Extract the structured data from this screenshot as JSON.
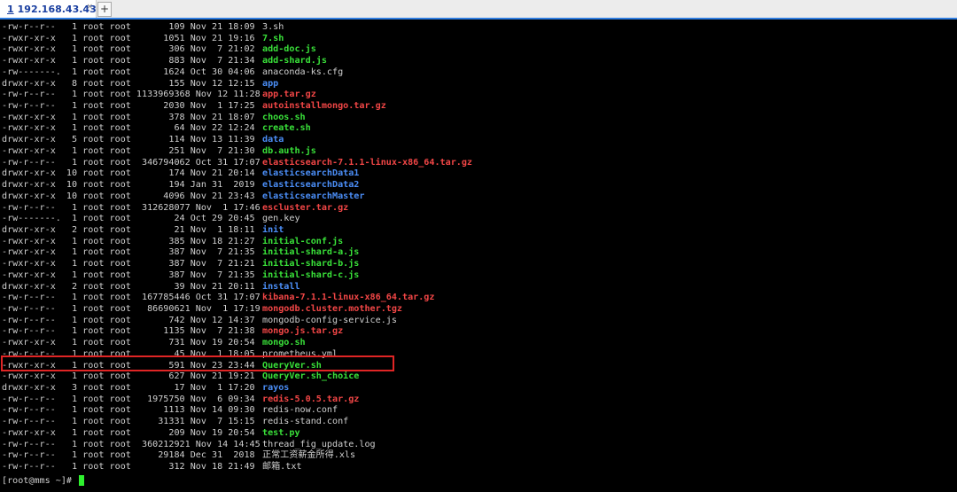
{
  "tab": {
    "number": "1",
    "host": "192.168.43.43",
    "close_glyph": "×",
    "add_glyph": "+"
  },
  "colors": {
    "green": "#39e039",
    "red": "#f24646",
    "blue": "#4b8ef7",
    "white": "#cfcfcf",
    "highlight": "#e02525"
  },
  "listing": [
    {
      "meta": "-rw-r--r--   1 root root       109 Nov 21 18:09",
      "name": "3.sh",
      "color": "white"
    },
    {
      "meta": "-rwxr-xr-x   1 root root      1051 Nov 21 19:16",
      "name": "7.sh",
      "color": "green"
    },
    {
      "meta": "-rwxr-xr-x   1 root root       306 Nov  7 21:02",
      "name": "add-doc.js",
      "color": "green"
    },
    {
      "meta": "-rwxr-xr-x   1 root root       883 Nov  7 21:34",
      "name": "add-shard.js",
      "color": "green"
    },
    {
      "meta": "-rw-------.  1 root root      1624 Oct 30 04:06",
      "name": "anaconda-ks.cfg",
      "color": "white"
    },
    {
      "meta": "drwxr-xr-x   8 root root       155 Nov 12 12:15",
      "name": "app",
      "color": "blue"
    },
    {
      "meta": "-rw-r--r--   1 root root 1133969368 Nov 12 11:28",
      "name": "app.tar.gz",
      "color": "red"
    },
    {
      "meta": "-rw-r--r--   1 root root      2030 Nov  1 17:25",
      "name": "autoinstallmongo.tar.gz",
      "color": "red"
    },
    {
      "meta": "-rwxr-xr-x   1 root root       378 Nov 21 18:07",
      "name": "choos.sh",
      "color": "green"
    },
    {
      "meta": "-rwxr-xr-x   1 root root        64 Nov 22 12:24",
      "name": "create.sh",
      "color": "green"
    },
    {
      "meta": "drwxr-xr-x   5 root root       114 Nov 13 11:39",
      "name": "data",
      "color": "blue"
    },
    {
      "meta": "-rwxr-xr-x   1 root root       251 Nov  7 21:30",
      "name": "db.auth.js",
      "color": "green"
    },
    {
      "meta": "-rw-r--r--   1 root root  346794062 Oct 31 17:07",
      "name": "elasticsearch-7.1.1-linux-x86_64.tar.gz",
      "color": "red"
    },
    {
      "meta": "drwxr-xr-x  10 root root       174 Nov 21 20:14",
      "name": "elasticsearchData1",
      "color": "blue"
    },
    {
      "meta": "drwxr-xr-x  10 root root       194 Jan 31  2019",
      "name": "elasticsearchData2",
      "color": "blue"
    },
    {
      "meta": "drwxr-xr-x  10 root root      4096 Nov 21 23:43",
      "name": "elasticsearchMaster",
      "color": "blue"
    },
    {
      "meta": "-rw-r--r--   1 root root  312628077 Nov  1 17:46",
      "name": "escluster.tar.gz",
      "color": "red"
    },
    {
      "meta": "-rw-------.  1 root root        24 Oct 29 20:45",
      "name": "gen.key",
      "color": "white"
    },
    {
      "meta": "drwxr-xr-x   2 root root        21 Nov  1 18:11",
      "name": "init",
      "color": "blue"
    },
    {
      "meta": "-rwxr-xr-x   1 root root       385 Nov 18 21:27",
      "name": "initial-conf.js",
      "color": "green"
    },
    {
      "meta": "-rwxr-xr-x   1 root root       387 Nov  7 21:35",
      "name": "initial-shard-a.js",
      "color": "green"
    },
    {
      "meta": "-rwxr-xr-x   1 root root       387 Nov  7 21:21",
      "name": "initial-shard-b.js",
      "color": "green"
    },
    {
      "meta": "-rwxr-xr-x   1 root root       387 Nov  7 21:35",
      "name": "initial-shard-c.js",
      "color": "green"
    },
    {
      "meta": "drwxr-xr-x   2 root root        39 Nov 21 20:11",
      "name": "install",
      "color": "blue"
    },
    {
      "meta": "-rw-r--r--   1 root root  167785446 Oct 31 17:07",
      "name": "kibana-7.1.1-linux-x86_64.tar.gz",
      "color": "red"
    },
    {
      "meta": "-rw-r--r--   1 root root   86690621 Nov  1 17:19",
      "name": "mongodb.cluster.mother.tgz",
      "color": "red"
    },
    {
      "meta": "-rw-r--r--   1 root root       742 Nov 12 14:37",
      "name": "mongodb-config-service.js",
      "color": "white"
    },
    {
      "meta": "-rw-r--r--   1 root root      1135 Nov  7 21:38",
      "name": "mongo.js.tar.gz",
      "color": "red"
    },
    {
      "meta": "-rwxr-xr-x   1 root root       731 Nov 19 20:54",
      "name": "mongo.sh",
      "color": "green"
    },
    {
      "meta": "-rw-r--r--   1 root root        45 Nov  1 18:05",
      "name": "prometheus.yml",
      "color": "white"
    },
    {
      "meta": "-rwxr-xr-x   1 root root       591 Nov 23 23:44",
      "name": "QueryVer.sh",
      "color": "green"
    },
    {
      "meta": "-rwxr-xr-x   1 root root       627 Nov 21 19:21",
      "name": "QueryVer.sh_choice",
      "color": "green"
    },
    {
      "meta": "drwxr-xr-x   3 root root        17 Nov  1 17:20",
      "name": "rayos",
      "color": "blue"
    },
    {
      "meta": "-rw-r--r--   1 root root   1975750 Nov  6 09:34",
      "name": "redis-5.0.5.tar.gz",
      "color": "red"
    },
    {
      "meta": "-rw-r--r--   1 root root      1113 Nov 14 09:30",
      "name": "redis-now.conf",
      "color": "white"
    },
    {
      "meta": "-rw-r--r--   1 root root     31331 Nov  7 15:15",
      "name": "redis-stand.conf",
      "color": "white"
    },
    {
      "meta": "-rwxr-xr-x   1 root root       209 Nov 19 20:54",
      "name": "test.py",
      "color": "green"
    },
    {
      "meta": "-rw-r--r--   1 root root  360212921 Nov 14 14:45",
      "name": "thread_fig_update.log",
      "color": "white"
    },
    {
      "meta": "-rw-r--r--   1 root root     29184 Dec 31  2018",
      "name": "正常工资薪金所得.xls",
      "color": "white"
    },
    {
      "meta": "-rw-r--r--   1 root root       312 Nov 18 21:49",
      "name": "邮箱.txt",
      "color": "white"
    }
  ],
  "prompt": "[root@mms ~]# "
}
